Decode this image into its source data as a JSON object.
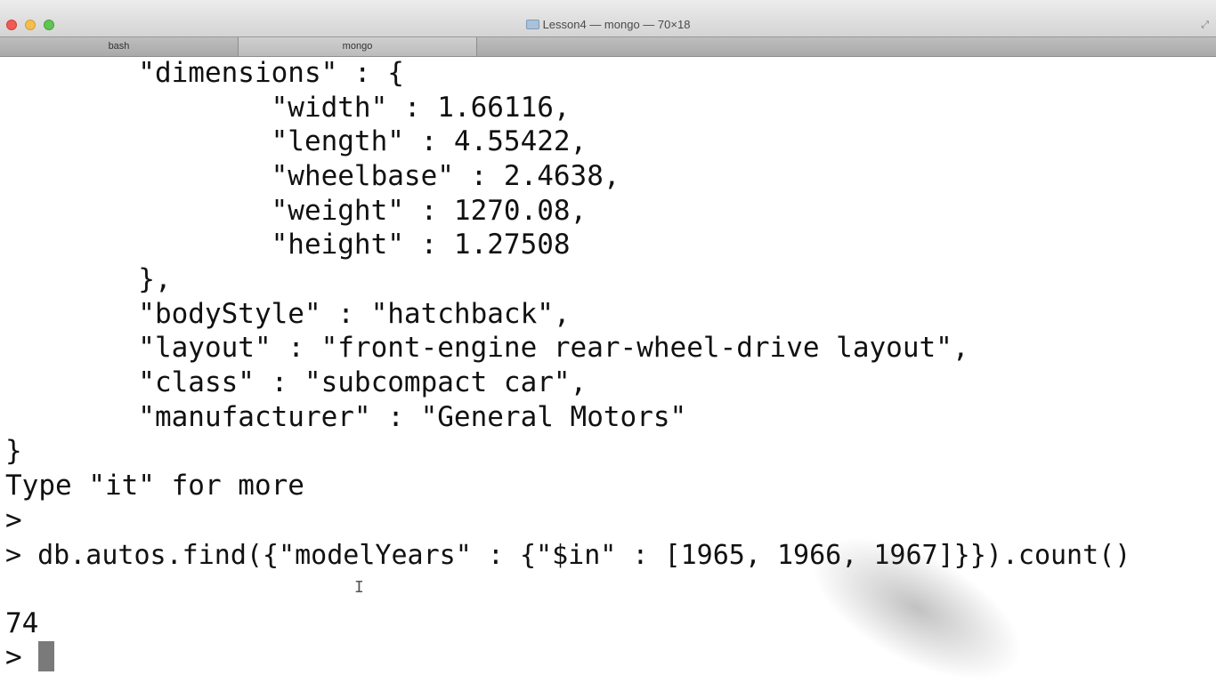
{
  "window": {
    "title": "Lesson4 — mongo — 70×18",
    "colors": {
      "close": "#ee5c54",
      "minimize": "#f5be4f",
      "maximize": "#61c454"
    }
  },
  "tabs": [
    {
      "label": "bash",
      "active": false
    },
    {
      "label": "mongo",
      "active": true
    }
  ],
  "terminal": {
    "lines": [
      "        \"dimensions\" : {",
      "                \"width\" : 1.66116,",
      "                \"length\" : 4.55422,",
      "                \"wheelbase\" : 2.4638,",
      "                \"weight\" : 1270.08,",
      "                \"height\" : 1.27508",
      "        },",
      "        \"bodyStyle\" : \"hatchback\",",
      "        \"layout\" : \"front-engine rear-wheel-drive layout\",",
      "        \"class\" : \"subcompact car\",",
      "        \"manufacturer\" : \"General Motors\"",
      "}",
      "Type \"it\" for more",
      ">",
      "> db.autos.find({\"modelYears\" : {\"$in\" : [1965, 1966, 1967]}}).count()",
      "",
      "74"
    ],
    "prompt": "> ",
    "cursor_glyph": "I"
  }
}
